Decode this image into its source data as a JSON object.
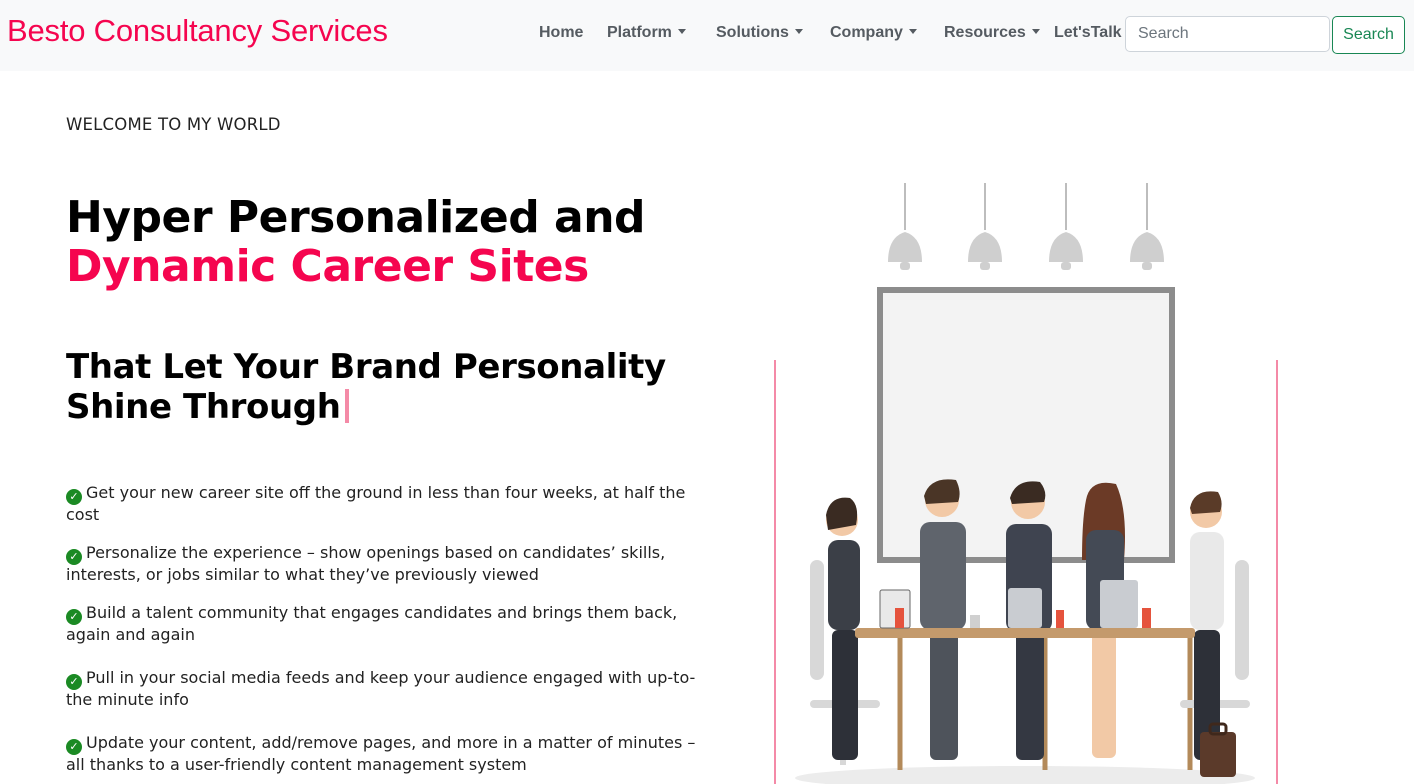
{
  "navbar": {
    "brand": "Besto Consultancy Services",
    "items": [
      {
        "label": "Home",
        "dropdown": false
      },
      {
        "label": "Platform",
        "dropdown": true
      },
      {
        "label": "Solutions",
        "dropdown": true
      },
      {
        "label": "Company",
        "dropdown": true
      },
      {
        "label": "Resources",
        "dropdown": true
      },
      {
        "label": "Let'sTalk",
        "dropdown": false
      }
    ],
    "search": {
      "placeholder": "Search",
      "value": "",
      "button_label": "Search"
    }
  },
  "hero": {
    "welcome": "WELCOME TO MY WORLD",
    "title_line1": "Hyper Personalized and",
    "title_line2": "Dynamic Career Sites",
    "subtitle": "That Let Your Brand Personality Shine Through"
  },
  "features": [
    "Get your new career site off the ground in less than four weeks, at half the cost",
    "Personalize the experience – show openings based on candidates’ skills, interests, or jobs similar to what they’ve previously viewed",
    "Build a talent community that engages candidates and brings them back, again and again",
    "Pull in your social media feeds and keep your audience engaged with up-to-the minute info",
    "Update your content, add/remove pages, and more in a matter of minutes – all thanks to a user-friendly content management system"
  ],
  "icons": {
    "feature_bullet": "check-circle-icon",
    "dropdown": "caret-down-icon"
  },
  "colors": {
    "brand": "#f5054f",
    "accent": "#f5054f",
    "success": "#198754",
    "check": "#1b8a24",
    "navbar_bg": "#f8f9fa"
  }
}
